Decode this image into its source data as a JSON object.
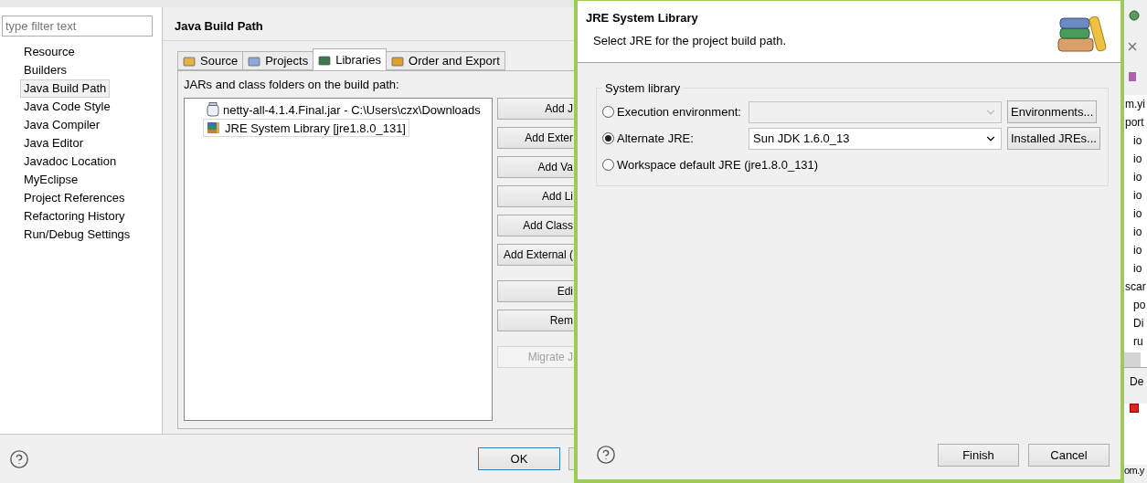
{
  "sidebar": {
    "filter": {
      "placeholder": "type filter text"
    },
    "items": [
      {
        "label": "Resource",
        "selected": false
      },
      {
        "label": "Builders",
        "selected": false
      },
      {
        "label": "Java Build Path",
        "selected": true
      },
      {
        "label": "Java Code Style",
        "selected": false
      },
      {
        "label": "Java Compiler",
        "selected": false
      },
      {
        "label": "Java Editor",
        "selected": false
      },
      {
        "label": "Javadoc Location",
        "selected": false
      },
      {
        "label": "MyEclipse",
        "selected": false
      },
      {
        "label": "Project References",
        "selected": false
      },
      {
        "label": "Refactoring History",
        "selected": false
      },
      {
        "label": "Run/Debug Settings",
        "selected": false
      }
    ]
  },
  "page": {
    "title": "Java Build Path",
    "tabs": [
      {
        "label": "Source",
        "selected": false
      },
      {
        "label": "Projects",
        "selected": false
      },
      {
        "label": "Libraries",
        "selected": true
      },
      {
        "label": "Order and Export",
        "selected": false
      }
    ],
    "list_label": "JARs and class folders on the build path:",
    "entries": [
      {
        "label": "netty-all-4.1.4.Final.jar - C:\\Users\\czx\\Downloads",
        "kind": "jar",
        "selected": false
      },
      {
        "label": "JRE System Library [jre1.8.0_131]",
        "kind": "library",
        "selected": true
      }
    ],
    "button_groups": [
      [
        {
          "label": "Add J",
          "disabled": false
        },
        {
          "label": "Add Exter",
          "disabled": false
        },
        {
          "label": "Add Va",
          "disabled": false
        },
        {
          "label": "Add Li",
          "disabled": false
        },
        {
          "label": "Add Class",
          "disabled": false
        },
        {
          "label": "Add External (",
          "disabled": false
        }
      ],
      [
        {
          "label": "Edi",
          "disabled": false
        },
        {
          "label": "Rem",
          "disabled": false
        }
      ],
      [
        {
          "label": "Migrate J",
          "disabled": true
        }
      ]
    ]
  },
  "footer": {
    "ok": "OK"
  },
  "jre_dialog": {
    "title": "JRE System Library",
    "subtitle": "Select JRE for the project build path.",
    "group": {
      "title": "System library",
      "options": [
        {
          "label": "Execution environment:",
          "selected": false,
          "combo": {
            "disabled": true
          },
          "button": "Environments..."
        },
        {
          "label": "Alternate JRE:",
          "selected": true,
          "combo": {
            "value": "Sun JDK 1.6.0_13",
            "disabled": false
          },
          "button": "Installed JREs..."
        },
        {
          "label": "Workspace default JRE (jre1.8.0_131)",
          "selected": false
        }
      ]
    },
    "buttons": [
      "Finish",
      "Cancel"
    ]
  },
  "background_editor": {
    "outline": [
      {
        "text": "m.yi"
      },
      {
        "text": "port",
        "children": [
          {
            "text": "io"
          },
          {
            "text": "io"
          },
          {
            "text": "io"
          },
          {
            "text": "io"
          },
          {
            "text": "io"
          },
          {
            "text": "io"
          },
          {
            "text": "io"
          },
          {
            "text": "io"
          }
        ]
      },
      {
        "text": "scar",
        "children": [
          {
            "text": "po"
          },
          {
            "text": "Di"
          },
          {
            "text": "ru"
          }
        ]
      }
    ],
    "console_tab": "De",
    "status": "om.y"
  }
}
